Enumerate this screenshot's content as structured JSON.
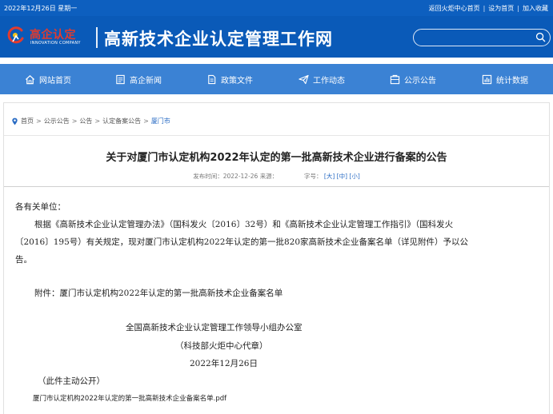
{
  "topbar": {
    "date": "2022年12月26日 星期一",
    "links": [
      "返回火炬中心首页",
      "设为首页",
      "加入收藏"
    ],
    "separator": "|"
  },
  "header": {
    "logo_cn": "高企认定",
    "logo_en": "INNOVATION COMPANY",
    "site_title": "高新技术企业认定管理工作网",
    "search_placeholder": ""
  },
  "nav": {
    "items": [
      {
        "label": "网站首页",
        "icon": "home-icon"
      },
      {
        "label": "高企新闻",
        "icon": "news-icon"
      },
      {
        "label": "政策文件",
        "icon": "document-icon"
      },
      {
        "label": "工作动态",
        "icon": "paper-plane-icon"
      },
      {
        "label": "公示公告",
        "icon": "announcement-icon"
      },
      {
        "label": "统计数据",
        "icon": "chart-icon"
      }
    ]
  },
  "breadcrumb": {
    "items": [
      "首页",
      "公示公告",
      "公告",
      "认定备案公告"
    ],
    "current": "厦门市",
    "separator": ">"
  },
  "article": {
    "title": "关于对厦门市认定机构2022年认定的第一批高新技术企业进行备案的公告",
    "meta_published": "发布时间：2022-12-26 来源：",
    "meta_fontsize_label": "字号：",
    "font_sizes": [
      "[大]",
      "[中]",
      "[小]"
    ],
    "salutation": "各有关单位：",
    "paragraph_line1": "根据《高新技术企业认定管理办法》（国科发火〔2016〕32号）和《高新技术企业认定管理工作指引》（国科发火",
    "paragraph_line2": "〔2016〕195号）有关规定，现对厦门市认定机构2022年认定的第一批820家高新技术企业备案名单（详见附件）予以公",
    "paragraph_line3": "告。",
    "attachment_line": "附件：厦门市认定机构2022年认定的第一批高新技术企业备案名单",
    "signature_org": "全国高新技术企业认定管理工作领导小组办公室",
    "signature_seal": "（科技部火炬中心代章）",
    "signature_date": "2022年12月26日",
    "public_note": "（此件主动公开）",
    "attachment_file": "厦门市认定机构2022年认定的第一批高新技术企业备案名单.pdf"
  },
  "colors": {
    "topbar": "#0d5fbf",
    "header": "#0a5ab8",
    "nav": "#3b82d4",
    "link": "#2a6cc4",
    "logo_red": "#e23b2e"
  }
}
